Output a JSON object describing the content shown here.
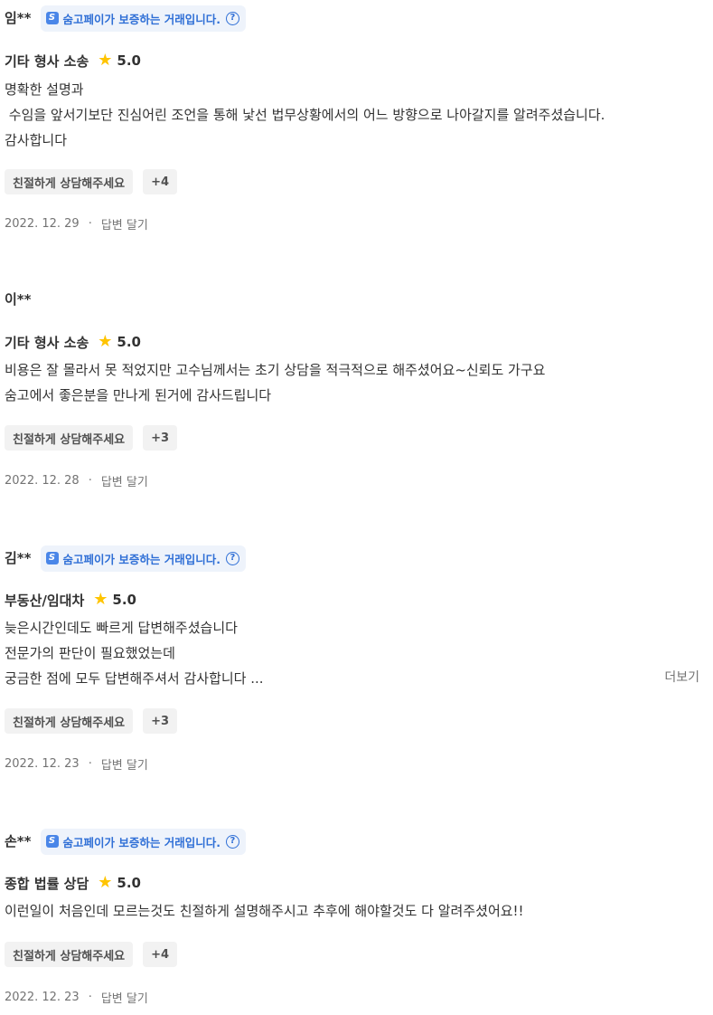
{
  "badge_text": "숨고페이가 보증하는 거래입니다.",
  "reviews": [
    {
      "user": "임**",
      "has_badge": true,
      "category": "기타 형사 소송",
      "rating": "5.0",
      "lines": [
        "명확한 설명과",
        " 수임을 앞서기보단 진심어린 조언을 통해 낯선 법무상황에서의 어느 방향으로 나아갈지를 알려주셨습니다.",
        "감사합니다"
      ],
      "tag": "친절하게 상담해주세요",
      "more_tags": "+4",
      "date": "2022. 12. 29",
      "reply": "답변 달기"
    },
    {
      "user": "이**",
      "has_badge": false,
      "category": "기타 형사 소송",
      "rating": "5.0",
      "lines": [
        "비용은 잘 몰라서 못 적었지만 고수님께서는 초기 상담을 적극적으로 해주셨어요~신뢰도 가구요",
        "숨고에서 좋은분을 만나게 된거에 감사드립니다"
      ],
      "tag": "친절하게 상담해주세요",
      "more_tags": "+3",
      "date": "2022. 12. 28",
      "reply": "답변 달기"
    },
    {
      "user": "김**",
      "has_badge": true,
      "category": "부동산/임대차",
      "rating": "5.0",
      "lines": [
        "늦은시간인데도 빠르게 답변해주셨습니다",
        "전문가의 판단이 필요했었는데",
        "궁금한 점에 모두 답변해주셔서 감사합니다 ..."
      ],
      "show_more": "더보기",
      "tag": "친절하게 상담해주세요",
      "more_tags": "+3",
      "date": "2022. 12. 23",
      "reply": "답변 달기"
    },
    {
      "user": "손**",
      "has_badge": true,
      "category": "종합 법률 상담",
      "rating": "5.0",
      "lines": [
        "이런일이 처음인데 모르는것도 친절하게 설명해주시고 추후에 해야할것도 다 알려주셨어요!!"
      ],
      "tag": "친절하게 상담해주세요",
      "more_tags": "+4",
      "date": "2022. 12. 23",
      "reply": "답변 달기"
    }
  ],
  "icons": {
    "logo": "soomgo-pay-logo-icon",
    "help": "question-circle-icon",
    "star": "star-icon"
  },
  "colors": {
    "star": "#ffc400",
    "badge_bg": "#eef3fb",
    "badge_text": "#2f6fd6",
    "tag_bg": "#f2f2f2"
  }
}
